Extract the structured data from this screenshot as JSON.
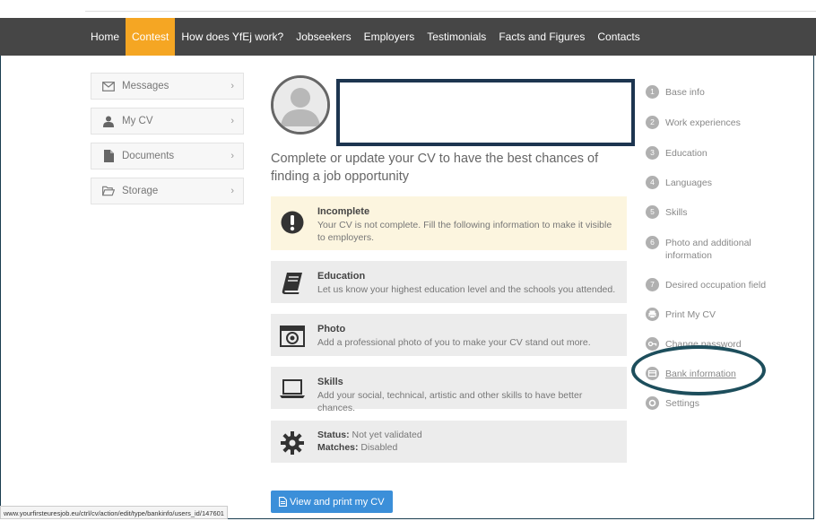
{
  "nav": {
    "items": [
      {
        "label": "Home",
        "active": false
      },
      {
        "label": "Contest",
        "active": true
      },
      {
        "label": "How does YfEj work?",
        "active": false
      },
      {
        "label": "Jobseekers",
        "active": false
      },
      {
        "label": "Employers",
        "active": false
      },
      {
        "label": "Testimonials",
        "active": false
      },
      {
        "label": "Facts and Figures",
        "active": false
      },
      {
        "label": "Contacts",
        "active": false
      }
    ],
    "active_color": "#f5a623",
    "bg_color": "#464646"
  },
  "left_menu": {
    "items": [
      {
        "label": "Messages",
        "icon": "envelope-icon"
      },
      {
        "label": "My CV",
        "icon": "user-icon"
      },
      {
        "label": "Documents",
        "icon": "document-icon"
      },
      {
        "label": "Storage",
        "icon": "folder-open-icon"
      }
    ],
    "chevron": "›"
  },
  "profile": {
    "headline": "Complete or update your CV to have the best chances of finding a job opportunity"
  },
  "cards": {
    "incomplete": {
      "title": "Incomplete",
      "text": "Your CV is not complete. Fill the following information to make it visible to employers."
    },
    "education": {
      "title": "Education",
      "text": "Let us know your highest education level and the schools you attended."
    },
    "photo": {
      "title": "Photo",
      "text": "Add a professional photo of you to make your CV stand out more."
    },
    "skills": {
      "title": "Skills",
      "text": "Add your social, technical, artistic and other skills to have better chances."
    },
    "status": {
      "status_label": "Status:",
      "status_value": " Not yet validated",
      "matches_label": "Matches:",
      "matches_value": " Disabled"
    }
  },
  "view_button": {
    "label": "View and print my CV"
  },
  "steps": [
    {
      "num": "1",
      "label": "Base info"
    },
    {
      "num": "2",
      "label": "Work experiences"
    },
    {
      "num": "3",
      "label": "Education"
    },
    {
      "num": "4",
      "label": "Languages"
    },
    {
      "num": "5",
      "label": "Skills"
    },
    {
      "num": "6",
      "label": "Photo and additional information"
    },
    {
      "num": "7",
      "label": "Desired occupation field"
    }
  ],
  "actions": [
    {
      "label": "Print My CV",
      "icon": "print-icon"
    },
    {
      "label": "Change password",
      "icon": "key-icon"
    },
    {
      "label": "Bank information",
      "icon": "card-icon"
    },
    {
      "label": "Settings",
      "icon": "gear-icon"
    }
  ],
  "statusbar": {
    "url": "www.yourfirsteuresjob.eu/ctrl/cv/action/edit/type/bankinfo/users_id/147601"
  },
  "colors": {
    "button": "#3b8fd9",
    "warn_bg": "#fcf5df",
    "card_bg": "#ececec",
    "annotation": "#1d4e5c"
  }
}
